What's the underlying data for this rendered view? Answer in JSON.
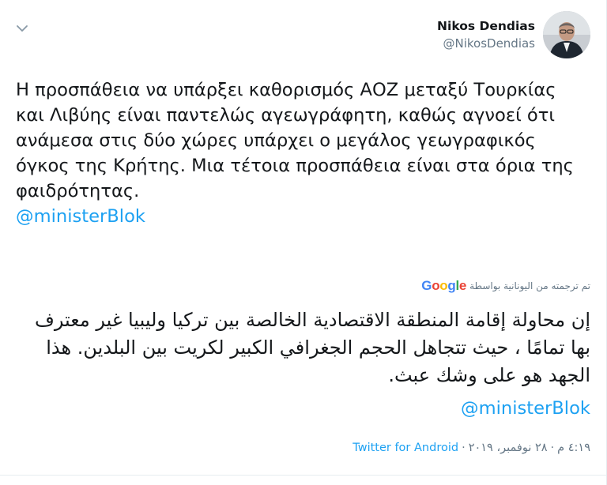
{
  "author": {
    "display_name": "Nikos Dendias",
    "handle": "@NikosDendias",
    "avatar_icon": "profile-photo"
  },
  "tweet": {
    "text": "Η προσπάθεια να υπάρξει καθορισμός ΑΟΖ μεταξύ Τουρκίας και Λιβύης είναι παντελώς αγεωγράφητη, καθώς αγνοεί ότι ανάμεσα στις δύο χώρες υπάρχει ο μεγάλος γεωγραφικός όγκος της Κρήτης. Μια τέτοια προσπάθεια είναι στα όρια της φαιδρότητας.",
    "mention": "@ministerBlok"
  },
  "translation": {
    "credit_label": "تم ترجمته من اليونانية بواسطة",
    "provider": "Google",
    "text": "إن محاولة إقامة المنطقة الاقتصادية الخالصة بين تركيا وليبيا غير معترف بها تمامًا ، حيث تتجاهل الحجم الجغرافي الكبير لكريت بين البلدين. هذا الجهد هو على وشك عبث.",
    "mention": "@ministerBlok"
  },
  "meta": {
    "time": "٤:١٩ م",
    "date": "٢٨ نوفمبر، ٢٠١٩",
    "separator": "·",
    "source": "Twitter for Android"
  },
  "colors": {
    "link": "#1da1f2",
    "secondary_text": "#657786",
    "google": [
      "#4285F4",
      "#EA4335",
      "#FBBC05",
      "#4285F4",
      "#34A853",
      "#EA4335"
    ]
  }
}
